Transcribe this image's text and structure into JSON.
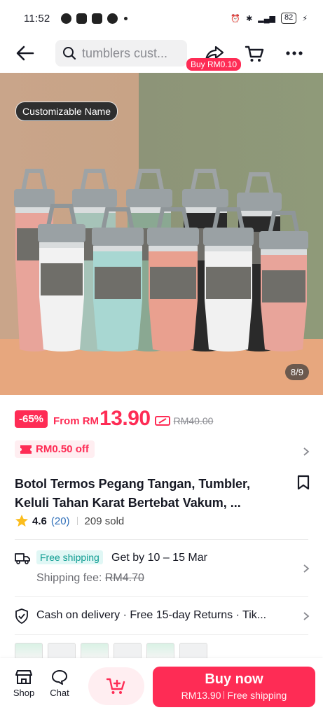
{
  "status_bar": {
    "time": "11:52",
    "battery": "82"
  },
  "nav": {
    "search_query": "tumblers cust...",
    "buy_pill": "Buy RM0.10"
  },
  "gallery": {
    "tag": "Customizable Name",
    "pager": "8/9"
  },
  "price": {
    "discount": "-65%",
    "from_label": "From RM",
    "amount": "13.90",
    "original": "RM40.00"
  },
  "voucher": {
    "label": "RM0.50 off"
  },
  "product": {
    "title": "Botol Termos Pegang Tangan, Tumbler, Keluli Tahan Karat Bertebat Vakum, ...",
    "rating": "4.6",
    "review_count": "(20)",
    "sold": "209 sold"
  },
  "shipping": {
    "badge": "Free shipping",
    "get_by": "Get by 10 – 15 Mar",
    "fee_label": "Shipping fee: ",
    "fee_original": "RM4.70"
  },
  "services": {
    "text": "Cash on delivery · Free 15-day Returns · Tik..."
  },
  "bottom_bar": {
    "shop": "Shop",
    "chat": "Chat",
    "buy_now": "Buy now",
    "buy_price": "RM13.90",
    "buy_shipping": "Free shipping"
  },
  "colors": {
    "accent": "#fe2c55",
    "free_shipping": "#0e9c92",
    "review_link": "#2f6fb9"
  },
  "tumbler_colors": [
    "#e8a49a",
    "#a6c3b8",
    "#8aa892",
    "#2a2a2a",
    "#2a2a2a",
    "#f2f2f2",
    "#a8d7d2",
    "#e9a08f",
    "#f1f1f1"
  ]
}
